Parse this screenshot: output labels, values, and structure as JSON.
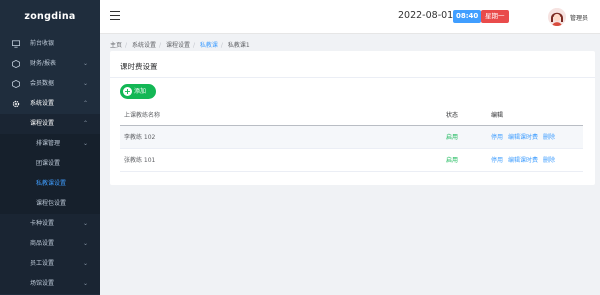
{
  "brand": "zongdina",
  "sidebar": {
    "items": [
      {
        "label": "前台收银",
        "icon": "monitor-icon"
      },
      {
        "label": "财务/报表",
        "icon": "cube-icon"
      },
      {
        "label": "会员数据",
        "icon": "cube-icon"
      },
      {
        "label": "系统设置",
        "icon": "gear-icon"
      }
    ],
    "sub": [
      {
        "label": "课程设置"
      },
      {
        "label": "排课管理"
      },
      {
        "label": "团课设置"
      },
      {
        "label": "私教课设置"
      },
      {
        "label": "课程包设置"
      },
      {
        "label": "卡种设置"
      },
      {
        "label": "商品设置"
      },
      {
        "label": "员工设置"
      },
      {
        "label": "场馆设置"
      }
    ]
  },
  "header": {
    "date": "2022-08-01",
    "time": "08:40",
    "weekday": "星期一",
    "user": "管理员"
  },
  "breadcrumb": [
    "主页",
    "系统设置",
    "课程设置",
    "私教课",
    "私教课1"
  ],
  "card": {
    "title": "课时费设置",
    "add_label": "添加",
    "columns": [
      "上课教练名称",
      "状态",
      "编辑"
    ],
    "rows": [
      {
        "name": "李教练 102",
        "status": "启用",
        "ops": [
          "停用",
          "编辑课时费",
          "删除"
        ]
      },
      {
        "name": "张教练 101",
        "status": "启用",
        "ops": [
          "停用",
          "编辑课时费",
          "删除"
        ]
      }
    ]
  },
  "colors": {
    "sidebar": "#1f2d3d",
    "accent": "#409eff",
    "success": "#13b755",
    "danger": "#e94b4b"
  }
}
